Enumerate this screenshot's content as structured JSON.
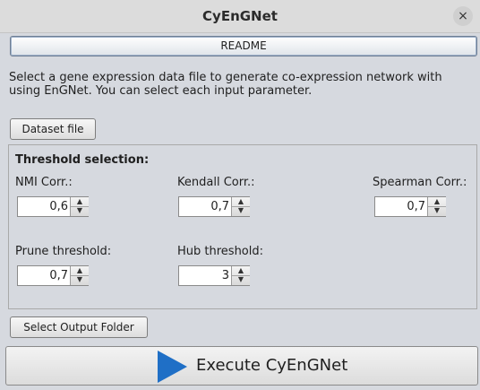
{
  "window": {
    "title": "CyEnGNet",
    "close_icon": "close-icon ×"
  },
  "readme_label": "README",
  "description": "Select a gene expression data file to generate co-expression network with using EnGNet. You can select each input parameter.",
  "dataset_button": "Dataset file",
  "threshold": {
    "title": "Threshold selection:",
    "nmi": {
      "label": "NMI Corr.:",
      "value": "0,6"
    },
    "kendall": {
      "label": "Kendall Corr.:",
      "value": "0,7"
    },
    "spearman": {
      "label": "Spearman Corr.:",
      "value": "0,7"
    },
    "prune": {
      "label": "Prune threshold:",
      "value": "0,7"
    },
    "hub": {
      "label": "Hub threshold:",
      "value": "3"
    }
  },
  "output_button": "Select Output Folder",
  "execute_button": "Execute CyEnGNet",
  "colors": {
    "accent_blue": "#1f6fc6"
  }
}
